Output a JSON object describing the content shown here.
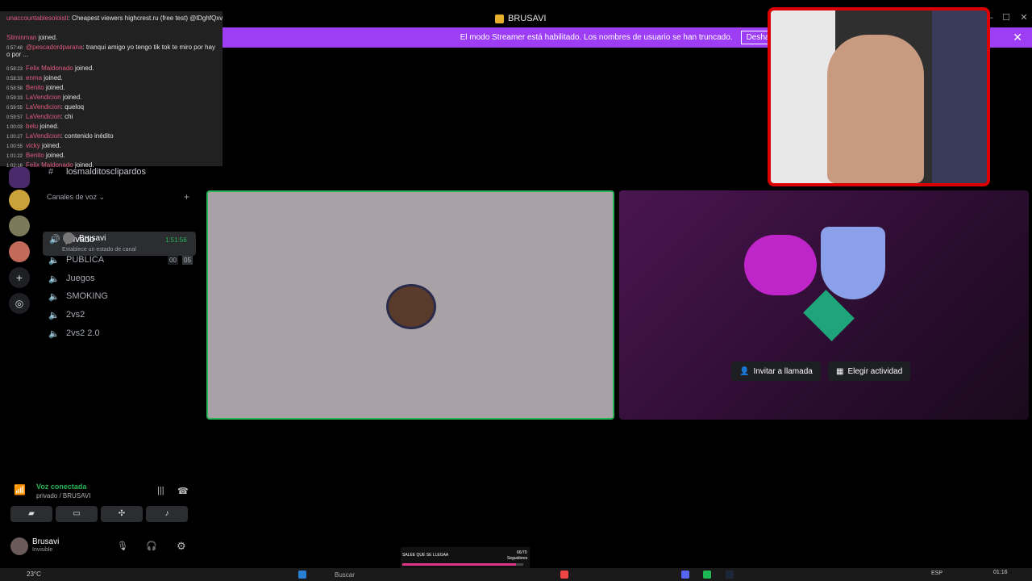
{
  "window": {
    "title": "BRUSAVI"
  },
  "banner": {
    "text": "El modo Streamer está habilitado. Los nombres de usuario se han truncado.",
    "button": "Deshabilitar"
  },
  "server": {
    "name": "BRUSAVI"
  },
  "chat": [
    {
      "time": "",
      "user": "unaccountablesoloisti",
      "msg": ": Cheapest viewers highcrest.ru (free test) @lDghfQxv"
    },
    {
      "time": "",
      "user": "Sliminman",
      "msg": " joined."
    },
    {
      "time": "0:57:48",
      "user": "@pescadordparana",
      "msg": ": tranqui amigo yo tengo tik tok te miro por hay o por ..."
    },
    {
      "time": "0:58:23",
      "user": "Felix Maldonado",
      "msg": " joined."
    },
    {
      "time": "0:58:33",
      "user": "enma",
      "msg": " joined."
    },
    {
      "time": "0:58:58",
      "user": "Benito",
      "msg": " joined."
    },
    {
      "time": "0:59:33",
      "user": "LaVendicion",
      "msg": " joined."
    },
    {
      "time": "0:59:55",
      "user": "LaVendicion",
      "msg": ": queloq"
    },
    {
      "time": "0:59:57",
      "user": "LaVendicion",
      "msg": ": chi"
    },
    {
      "time": "1:00:03",
      "user": "belu",
      "msg": " joined."
    },
    {
      "time": "1:00:27",
      "user": "LaVendicion",
      "msg": ": contenido inédito"
    },
    {
      "time": "1:00:55",
      "user": "vicky",
      "msg": " joined."
    },
    {
      "time": "1:01:22",
      "user": "Benito",
      "msg": " joined."
    },
    {
      "time": "1:02:16",
      "user": "Felix Maldonado",
      "msg": " joined."
    }
  ],
  "channels": {
    "text_channel": "losmalditosclipardos",
    "voice_section": "Canales de voz",
    "voice": [
      {
        "name": "privado",
        "timer": "1:51:56",
        "sub": "Establece un estado de canal",
        "member": "Brusavi"
      },
      {
        "name": "PUBLICA",
        "count_a": "00",
        "count_b": "05"
      },
      {
        "name": "Juegos"
      },
      {
        "name": "SMOKING"
      },
      {
        "name": "2vs2"
      },
      {
        "name": "2vs2 2.0"
      }
    ]
  },
  "voice_panel": {
    "status": "Voz conectada",
    "location": "privado / BRUSAVI"
  },
  "user": {
    "name": "Brusavi",
    "status": "Invisible"
  },
  "stage": {
    "invite": "Invitar a llamada",
    "activity": "Elegir actividad"
  },
  "taskbar": {
    "temp": "23°C",
    "search": "Buscar",
    "lang": "ESP",
    "time": "01:16"
  },
  "overlay": {
    "text": "SALEE QUE SE LLEGAA",
    "count": "66/70",
    "label": "Seguidores"
  },
  "colors": {
    "accent": "#9d3ef5",
    "green": "#27b555",
    "cam_border": "#dd0000"
  }
}
